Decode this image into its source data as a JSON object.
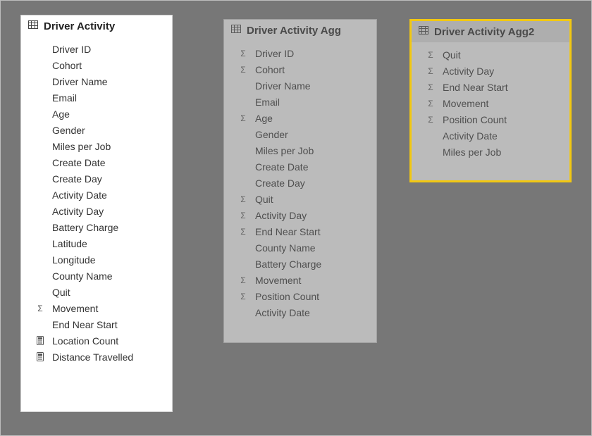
{
  "tables": [
    {
      "id": "card1",
      "title": "Driver Activity",
      "style": "normal",
      "fields": [
        {
          "icon": "none",
          "name": "Driver ID"
        },
        {
          "icon": "none",
          "name": "Cohort"
        },
        {
          "icon": "none",
          "name": "Driver Name"
        },
        {
          "icon": "none",
          "name": "Email"
        },
        {
          "icon": "none",
          "name": "Age"
        },
        {
          "icon": "none",
          "name": "Gender"
        },
        {
          "icon": "none",
          "name": "Miles per Job"
        },
        {
          "icon": "none",
          "name": "Create Date"
        },
        {
          "icon": "none",
          "name": "Create Day"
        },
        {
          "icon": "none",
          "name": "Activity Date"
        },
        {
          "icon": "none",
          "name": "Activity Day"
        },
        {
          "icon": "none",
          "name": "Battery Charge"
        },
        {
          "icon": "none",
          "name": "Latitude"
        },
        {
          "icon": "none",
          "name": "Longitude"
        },
        {
          "icon": "none",
          "name": "County Name"
        },
        {
          "icon": "none",
          "name": "Quit"
        },
        {
          "icon": "sigma",
          "name": "Movement"
        },
        {
          "icon": "none",
          "name": "End Near Start"
        },
        {
          "icon": "calc",
          "name": "Location Count"
        },
        {
          "icon": "calc",
          "name": "Distance Travelled"
        }
      ]
    },
    {
      "id": "card2",
      "title": "Driver Activity Agg",
      "style": "dim",
      "fields": [
        {
          "icon": "sigma",
          "name": "Driver ID"
        },
        {
          "icon": "sigma",
          "name": "Cohort"
        },
        {
          "icon": "none",
          "name": "Driver Name"
        },
        {
          "icon": "none",
          "name": "Email"
        },
        {
          "icon": "sigma",
          "name": "Age"
        },
        {
          "icon": "none",
          "name": "Gender"
        },
        {
          "icon": "none",
          "name": "Miles per Job"
        },
        {
          "icon": "none",
          "name": "Create Date"
        },
        {
          "icon": "none",
          "name": "Create Day"
        },
        {
          "icon": "sigma",
          "name": "Quit"
        },
        {
          "icon": "sigma",
          "name": "Activity Day"
        },
        {
          "icon": "sigma",
          "name": "End Near Start"
        },
        {
          "icon": "none",
          "name": "County Name"
        },
        {
          "icon": "none",
          "name": "Battery Charge"
        },
        {
          "icon": "sigma",
          "name": "Movement"
        },
        {
          "icon": "sigma",
          "name": "Position Count"
        },
        {
          "icon": "none",
          "name": "Activity Date"
        }
      ]
    },
    {
      "id": "card3",
      "title": "Driver Activity Agg2",
      "style": "selected",
      "fields": [
        {
          "icon": "sigma",
          "name": "Quit"
        },
        {
          "icon": "sigma",
          "name": "Activity Day"
        },
        {
          "icon": "sigma",
          "name": "End Near Start"
        },
        {
          "icon": "sigma",
          "name": "Movement"
        },
        {
          "icon": "sigma",
          "name": "Position Count"
        },
        {
          "icon": "none",
          "name": "Activity Date"
        },
        {
          "icon": "none",
          "name": "Miles per Job"
        }
      ]
    }
  ]
}
